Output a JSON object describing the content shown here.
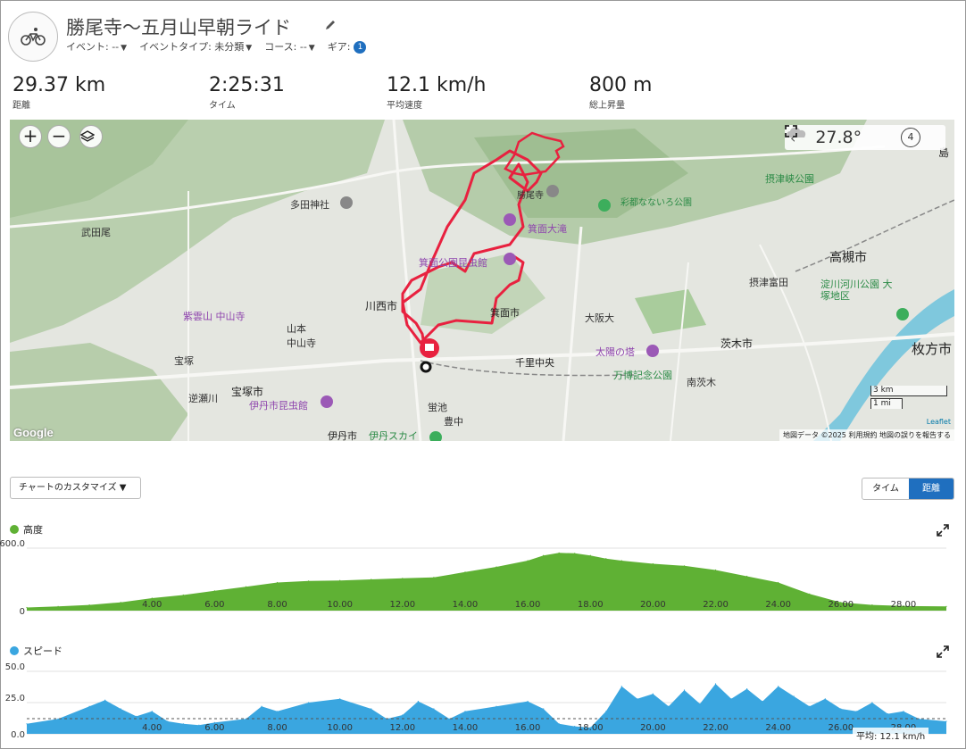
{
  "header": {
    "title": "勝尾寺〜五月山早朝ライド",
    "event_label": "イベント: --",
    "event_type_label": "イベントタイプ: 未分類",
    "course_label": "コース: --",
    "gear_label": "ギア:",
    "gear_count": "1",
    "icon": "cycling-icon"
  },
  "stats": [
    {
      "value": "29.37 km",
      "label": "距離"
    },
    {
      "value": "2:25:31",
      "label": "タイム"
    },
    {
      "value": "12.1 km/h",
      "label": "平均速度"
    },
    {
      "value": "800 m",
      "label": "総上昇量"
    }
  ],
  "map": {
    "zoom_in": "+",
    "zoom_out": "−",
    "temperature": "27.8°",
    "wind_speed": "4",
    "scale_km": "3 km",
    "scale_mi": "1 mi",
    "leaflet": "Leaflet",
    "attribution": "地図データ ©2025   利用規約   地図の誤りを報告する",
    "google": "Google",
    "places": [
      "勝尾寺",
      "彩都なないろ公園",
      "摂津峡公園",
      "高槻市",
      "摂津富田",
      "淀川河川公園 大塚地区",
      "茨木市",
      "枚方市",
      "箕面公園昆虫館",
      "箕面大滝",
      "多田神社",
      "武田尾",
      "川西市",
      "紫雲山 中山寺",
      "山本",
      "中山寺",
      "宝塚",
      "宝塚市",
      "逆瀬川",
      "伊丹市昆虫館",
      "伊丹市",
      "伊丹スカイ",
      "蛍池",
      "豊中",
      "箕面市",
      "千里中央",
      "大阪大",
      "太陽の塔",
      "万博記念公園",
      "南茨木",
      "島"
    ]
  },
  "charts": {
    "customize_label": "チャートのカスタマイズ ▼",
    "toggle_time": "タイム",
    "toggle_distance": "距離",
    "elevation_title": "高度",
    "speed_title": "スピード",
    "speed_avg_label": "平均: 12.1 km/h"
  },
  "colors": {
    "elevation": "#5fb134",
    "speed": "#3aa6e0",
    "route": "#e8213f",
    "accent": "#1f6fbf"
  },
  "chart_data": [
    {
      "type": "area",
      "title": "高度",
      "x_ticks": [
        "4.00",
        "6.00",
        "8.00",
        "10.00",
        "12.00",
        "14.00",
        "16.00",
        "18.00",
        "20.00",
        "22.00",
        "24.00",
        "26.00",
        "28.00"
      ],
      "y_ticks": [
        "0",
        "600.0"
      ],
      "ylim": [
        0,
        600
      ],
      "x": [
        0,
        1,
        2,
        3,
        4,
        5,
        6,
        7,
        8,
        9,
        10,
        11,
        12,
        13,
        14,
        15,
        16,
        16.5,
        17,
        17.5,
        18,
        18.5,
        19,
        20,
        21,
        22,
        23,
        24,
        25,
        26,
        27,
        28,
        29.37
      ],
      "y": [
        30,
        40,
        55,
        80,
        120,
        150,
        190,
        230,
        270,
        285,
        290,
        300,
        310,
        320,
        370,
        420,
        480,
        530,
        555,
        550,
        530,
        500,
        480,
        450,
        430,
        390,
        330,
        270,
        160,
        80,
        55,
        45,
        40
      ]
    },
    {
      "type": "area",
      "title": "スピード",
      "x_ticks": [
        "4.00",
        "6.00",
        "8.00",
        "10.00",
        "12.00",
        "14.00",
        "16.00",
        "18.00",
        "20.00",
        "22.00",
        "24.00",
        "26.00",
        "28.00"
      ],
      "y_ticks": [
        "0.0",
        "25.0",
        "50.0"
      ],
      "ylim": [
        0,
        50
      ],
      "average": 12.1,
      "x": [
        0,
        1,
        2,
        2.5,
        3,
        3.5,
        4,
        4.5,
        5,
        5.5,
        6,
        7,
        7.5,
        8,
        9,
        10,
        11,
        11.5,
        12,
        12.5,
        13,
        13.5,
        14,
        15,
        16,
        16.5,
        17,
        17.5,
        18,
        18.5,
        19,
        19.5,
        20,
        20.5,
        21,
        21.5,
        22,
        22.5,
        23,
        23.5,
        24,
        24.5,
        25,
        25.5,
        26,
        26.5,
        27,
        27.5,
        28,
        28.5,
        29.37
      ],
      "y": [
        8,
        12,
        22,
        27,
        20,
        14,
        18,
        10,
        8,
        7,
        9,
        12,
        22,
        18,
        25,
        28,
        20,
        12,
        15,
        26,
        20,
        12,
        18,
        22,
        26,
        20,
        8,
        6,
        5,
        18,
        38,
        28,
        32,
        22,
        35,
        24,
        40,
        28,
        36,
        26,
        38,
        30,
        22,
        28,
        20,
        18,
        25,
        16,
        18,
        12,
        10
      ]
    }
  ]
}
